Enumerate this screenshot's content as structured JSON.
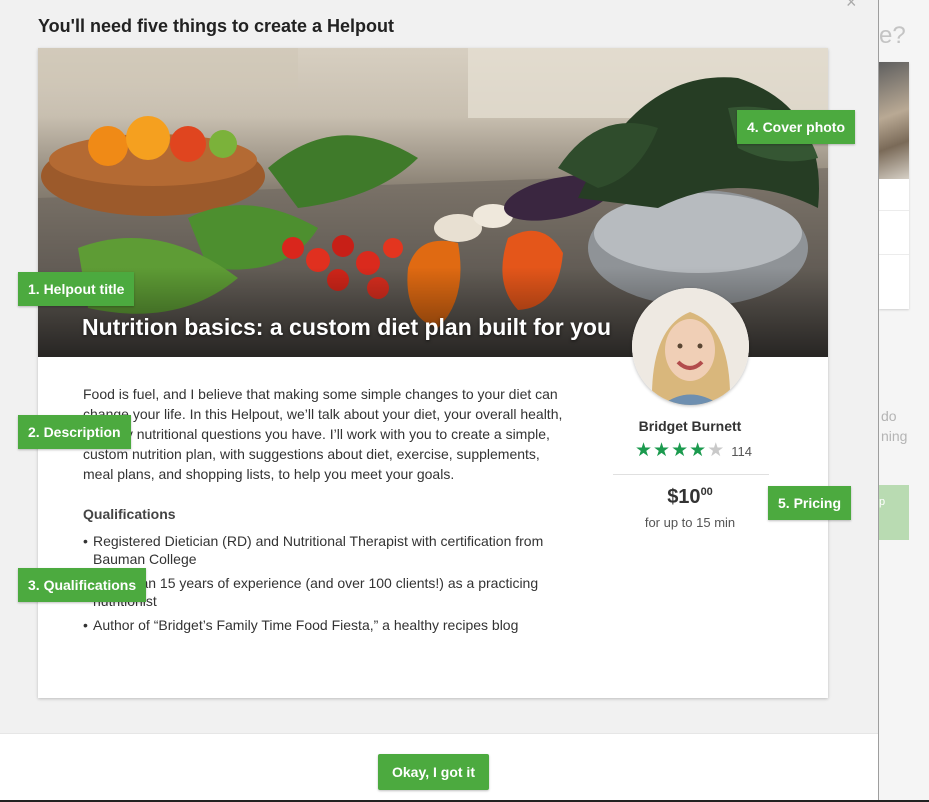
{
  "colors": {
    "accent_green": "#4caa3f",
    "star_green": "#1b9a4e",
    "star_empty": "#c9c9c9"
  },
  "background_page": {
    "heading_fragment": "ke?",
    "text_line_1": "do",
    "text_line_2": "ning",
    "button_fragment": "p"
  },
  "modal": {
    "title": "You'll need five things to create a Helpout",
    "close_icon": "close-icon"
  },
  "card": {
    "cover_image": "kitchen-vegetables-cover-photo",
    "title": "Nutrition basics: a custom diet plan built for you",
    "description": "Food is fuel, and I believe that making some simple changes to your diet can change your life. In this Helpout, we’ll talk about your diet, your overall health, and any nutritional questions you have. I’ll work with you to create a simple, custom nutrition plan, with suggestions about diet, exercise, supplements, meal plans, and shopping lists, to help you meet your goals.",
    "qualifications_heading": "Qualifications",
    "qualifications": [
      "Registered Dietician (RD) and Nutritional Therapist with certification from Bauman College",
      "More than 15 years of experience (and over 100 clients!) as a practicing nutritionist",
      "Author of “Bridget’s Family Time Food Fiesta,” a healthy recipes blog"
    ],
    "host": {
      "name": "Bridget Burnett",
      "rating": 4,
      "rating_max": 5,
      "review_count": "114",
      "price_dollars": "$10",
      "price_cents": "00",
      "price_note": "for up to 15 min"
    }
  },
  "tags": {
    "title": "1. Helpout title",
    "description": "2. Description",
    "qualifications": "3. Qualifications",
    "cover_photo": "4. Cover photo",
    "pricing": "5. Pricing"
  },
  "footer": {
    "ok_label": "Okay, I got it"
  }
}
